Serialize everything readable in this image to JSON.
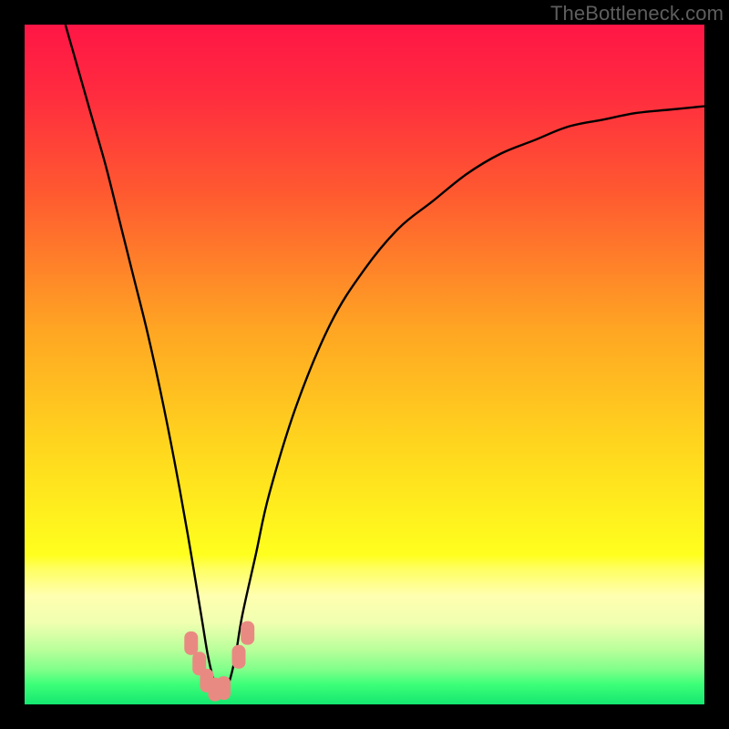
{
  "watermark": "TheBottleneck.com",
  "chart_data": {
    "type": "line",
    "title": "",
    "xlabel": "",
    "ylabel": "",
    "xlim": [
      0,
      100
    ],
    "ylim": [
      0,
      100
    ],
    "grid": false,
    "legend": false,
    "description": "Bottleneck percentage curve over a red-to-green vertical gradient. The black curve descends steeply from the upper left, reaches a minimum near x≈28 (green zone), then rises toward the upper right. Small salmon-colored markers sit near the trough.",
    "gradient_stops": [
      {
        "pct": 0,
        "color": "#ff1646"
      },
      {
        "pct": 10,
        "color": "#ff2b3f"
      },
      {
        "pct": 25,
        "color": "#ff5a30"
      },
      {
        "pct": 45,
        "color": "#ffa623"
      },
      {
        "pct": 62,
        "color": "#ffd61e"
      },
      {
        "pct": 78,
        "color": "#ffff1e"
      },
      {
        "pct": 80,
        "color": "#ffff60"
      },
      {
        "pct": 84,
        "color": "#ffffb0"
      },
      {
        "pct": 88,
        "color": "#f0ffb0"
      },
      {
        "pct": 92,
        "color": "#b8ff9a"
      },
      {
        "pct": 95,
        "color": "#7dff8a"
      },
      {
        "pct": 97,
        "color": "#3eff78"
      },
      {
        "pct": 100,
        "color": "#14e770"
      }
    ],
    "series": [
      {
        "name": "bottleneck-curve",
        "color": "#000000",
        "x": [
          6,
          8,
          10,
          12,
          14,
          16,
          18,
          20,
          22,
          24,
          26,
          27,
          28,
          29,
          30,
          31,
          32,
          34,
          36,
          40,
          45,
          50,
          55,
          60,
          65,
          70,
          75,
          80,
          85,
          90,
          95,
          100
        ],
        "y": [
          100,
          93,
          86,
          79,
          71,
          63,
          55,
          46,
          36,
          25,
          13,
          7,
          3,
          1,
          3,
          7,
          13,
          22,
          31,
          44,
          56,
          64,
          70,
          74,
          78,
          81,
          83,
          85,
          86,
          87,
          87.5,
          88
        ]
      }
    ],
    "markers": [
      {
        "x": 24.5,
        "y": 9,
        "color": "#e98a82"
      },
      {
        "x": 25.7,
        "y": 6,
        "color": "#e98a82"
      },
      {
        "x": 26.8,
        "y": 3.5,
        "color": "#e98a82"
      },
      {
        "x": 28.0,
        "y": 2.2,
        "color": "#e98a82"
      },
      {
        "x": 29.3,
        "y": 2.4,
        "color": "#e98a82"
      },
      {
        "x": 31.5,
        "y": 7,
        "color": "#e98a82"
      },
      {
        "x": 32.8,
        "y": 10.5,
        "color": "#e98a82"
      }
    ]
  }
}
